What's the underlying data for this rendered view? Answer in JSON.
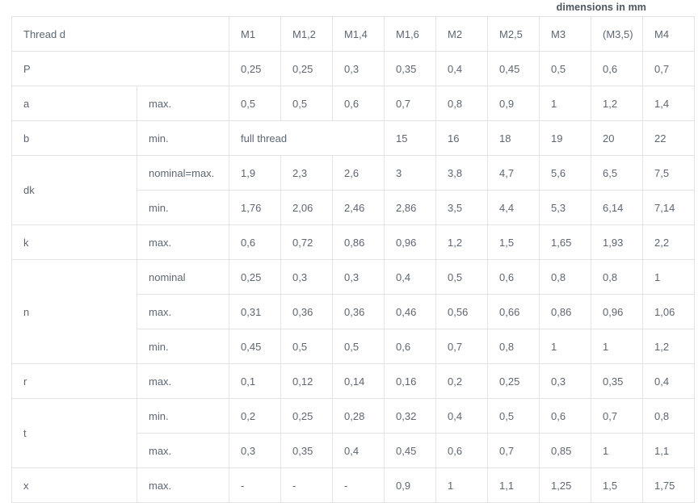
{
  "caption": "dimensions in mm",
  "table": {
    "header": {
      "label": "Thread d",
      "columns": [
        "M1",
        "M1,2",
        "M1,4",
        "M1,6",
        "M2",
        "M2,5",
        "M3",
        "(M3,5)",
        "M4"
      ]
    },
    "rows": [
      {
        "label": "P",
        "qualifier": "",
        "label_span": 2,
        "values": [
          "0,25",
          "0,25",
          "0,3",
          "0,35",
          "0,4",
          "0,45",
          "0,5",
          "0,6",
          "0,7"
        ]
      },
      {
        "label": "a",
        "qualifier": "max.",
        "values": [
          "0,5",
          "0,5",
          "0,6",
          "0,7",
          "0,8",
          "0,9",
          "1",
          "1,2",
          "1,4"
        ]
      },
      {
        "label": "b",
        "qualifier": "min.",
        "merged_first": {
          "text": "full thread",
          "span": 3
        },
        "values": [
          "15",
          "16",
          "18",
          "19",
          "20",
          "22"
        ]
      },
      {
        "label": "dk",
        "qualifier": "nominal=max.",
        "label_rowspan": 2,
        "values": [
          "1,9",
          "2,3",
          "2,6",
          "3",
          "3,8",
          "4,7",
          "5,6",
          "6,5",
          "7,5"
        ]
      },
      {
        "label": "",
        "qualifier": "min.",
        "continues": true,
        "values": [
          "1,76",
          "2,06",
          "2,46",
          "2,86",
          "3,5",
          "4,4",
          "5,3",
          "6,14",
          "7,14"
        ]
      },
      {
        "label": "k",
        "qualifier": "max.",
        "values": [
          "0,6",
          "0,72",
          "0,86",
          "0,96",
          "1,2",
          "1,5",
          "1,65",
          "1,93",
          "2,2"
        ]
      },
      {
        "label": "n",
        "qualifier": "nominal",
        "label_rowspan": 3,
        "values": [
          "0,25",
          "0,3",
          "0,3",
          "0,4",
          "0,5",
          "0,6",
          "0,8",
          "0,8",
          "1"
        ]
      },
      {
        "label": "",
        "qualifier": "max.",
        "continues": true,
        "values": [
          "0,31",
          "0,36",
          "0,36",
          "0,46",
          "0,56",
          "0,66",
          "0,86",
          "0,96",
          "1,06"
        ]
      },
      {
        "label": "",
        "qualifier": "min.",
        "continues": true,
        "values": [
          "0,45",
          "0,5",
          "0,5",
          "0,6",
          "0,7",
          "0,8",
          "1",
          "1",
          "1,2"
        ]
      },
      {
        "label": "r",
        "qualifier": "max.",
        "values": [
          "0,1",
          "0,12",
          "0,14",
          "0,16",
          "0,2",
          "0,25",
          "0,3",
          "0,35",
          "0,4"
        ]
      },
      {
        "label": "t",
        "qualifier": "min.",
        "label_rowspan": 2,
        "values": [
          "0,2",
          "0,25",
          "0,28",
          "0,32",
          "0,4",
          "0,5",
          "0,6",
          "0,7",
          "0,8"
        ]
      },
      {
        "label": "",
        "qualifier": "max.",
        "continues": true,
        "values": [
          "0,3",
          "0,35",
          "0,4",
          "0,45",
          "0,6",
          "0,7",
          "0,85",
          "1",
          "1,1"
        ]
      },
      {
        "label": "x",
        "qualifier": "max.",
        "values": [
          "-",
          "-",
          "-",
          "0,9",
          "1",
          "1,1",
          "1,25",
          "1,5",
          "1,75"
        ]
      }
    ]
  }
}
